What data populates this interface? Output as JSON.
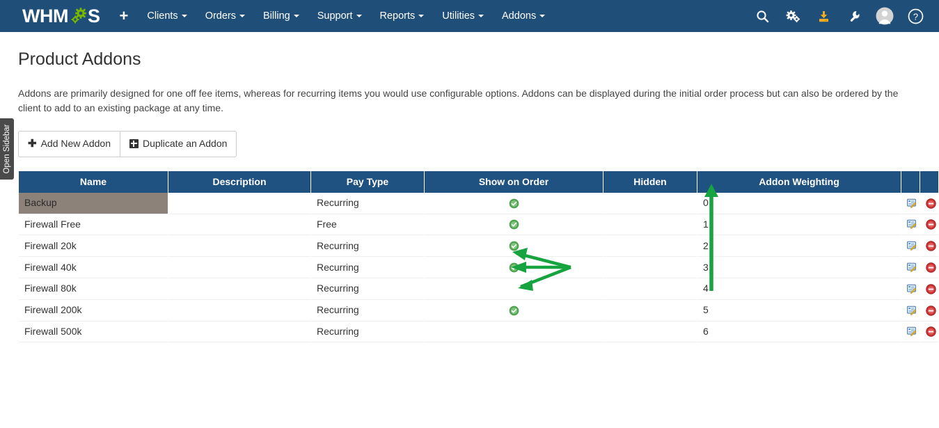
{
  "navbar": {
    "brand": "WHMCS",
    "add_label": "+",
    "menu": [
      {
        "label": "Clients",
        "caret": true
      },
      {
        "label": "Orders",
        "caret": true
      },
      {
        "label": "Billing",
        "caret": true
      },
      {
        "label": "Support",
        "caret": true
      },
      {
        "label": "Reports",
        "caret": true
      },
      {
        "label": "Utilities",
        "caret": true
      },
      {
        "label": "Addons",
        "caret": true
      }
    ],
    "icons": [
      {
        "name": "search-icon"
      },
      {
        "name": "cogs-icon"
      },
      {
        "name": "download-icon"
      },
      {
        "name": "wrench-icon"
      },
      {
        "name": "user-avatar-icon"
      },
      {
        "name": "help-icon"
      }
    ],
    "colors": {
      "background": "#1f4e79",
      "download_accent": "#f0ad22"
    }
  },
  "sidebar_toggle": {
    "label": "Open Sidebar"
  },
  "page": {
    "title": "Product Addons",
    "description": "Addons are primarily designed for one off fee items, whereas for recurring items you would use configurable options. Addons can be displayed during the initial order process but can also be ordered by the client to add to an existing package at any time."
  },
  "toolbar": {
    "add_new_label": "Add New Addon",
    "duplicate_label": "Duplicate an Addon"
  },
  "table": {
    "headers": [
      "Name",
      "Description",
      "Pay Type",
      "Show on Order",
      "Hidden",
      "Addon Weighting",
      "",
      ""
    ],
    "header_color": "#1f5181",
    "highlight_color": "#8c8279",
    "rows": [
      {
        "name": "Backup",
        "description": "",
        "pay_type": "Recurring",
        "show_on_order": true,
        "hidden": "",
        "weighting": "0",
        "highlighted": true
      },
      {
        "name": "Firewall Free",
        "description": "",
        "pay_type": "Free",
        "show_on_order": true,
        "hidden": "",
        "weighting": "1",
        "highlighted": false
      },
      {
        "name": "Firewall 20k",
        "description": "",
        "pay_type": "Recurring",
        "show_on_order": true,
        "hidden": "",
        "weighting": "2",
        "highlighted": false
      },
      {
        "name": "Firewall 40k",
        "description": "",
        "pay_type": "Recurring",
        "show_on_order": true,
        "hidden": "",
        "weighting": "3",
        "highlighted": false
      },
      {
        "name": "Firewall 80k",
        "description": "",
        "pay_type": "Recurring",
        "show_on_order": false,
        "hidden": "",
        "weighting": "4",
        "highlighted": false
      },
      {
        "name": "Firewall 200k",
        "description": "",
        "pay_type": "Recurring",
        "show_on_order": true,
        "hidden": "",
        "weighting": "5",
        "highlighted": false
      },
      {
        "name": "Firewall 500k",
        "description": "",
        "pay_type": "Recurring",
        "show_on_order": false,
        "hidden": "",
        "weighting": "6",
        "highlighted": false
      }
    ],
    "row_actions": {
      "edit": "edit-icon",
      "delete": "delete-icon"
    }
  },
  "annotations": {
    "color": "#17a33f",
    "fan_arrows_target_row": "Firewall 200k",
    "vertical_arrow_direction": "up"
  }
}
